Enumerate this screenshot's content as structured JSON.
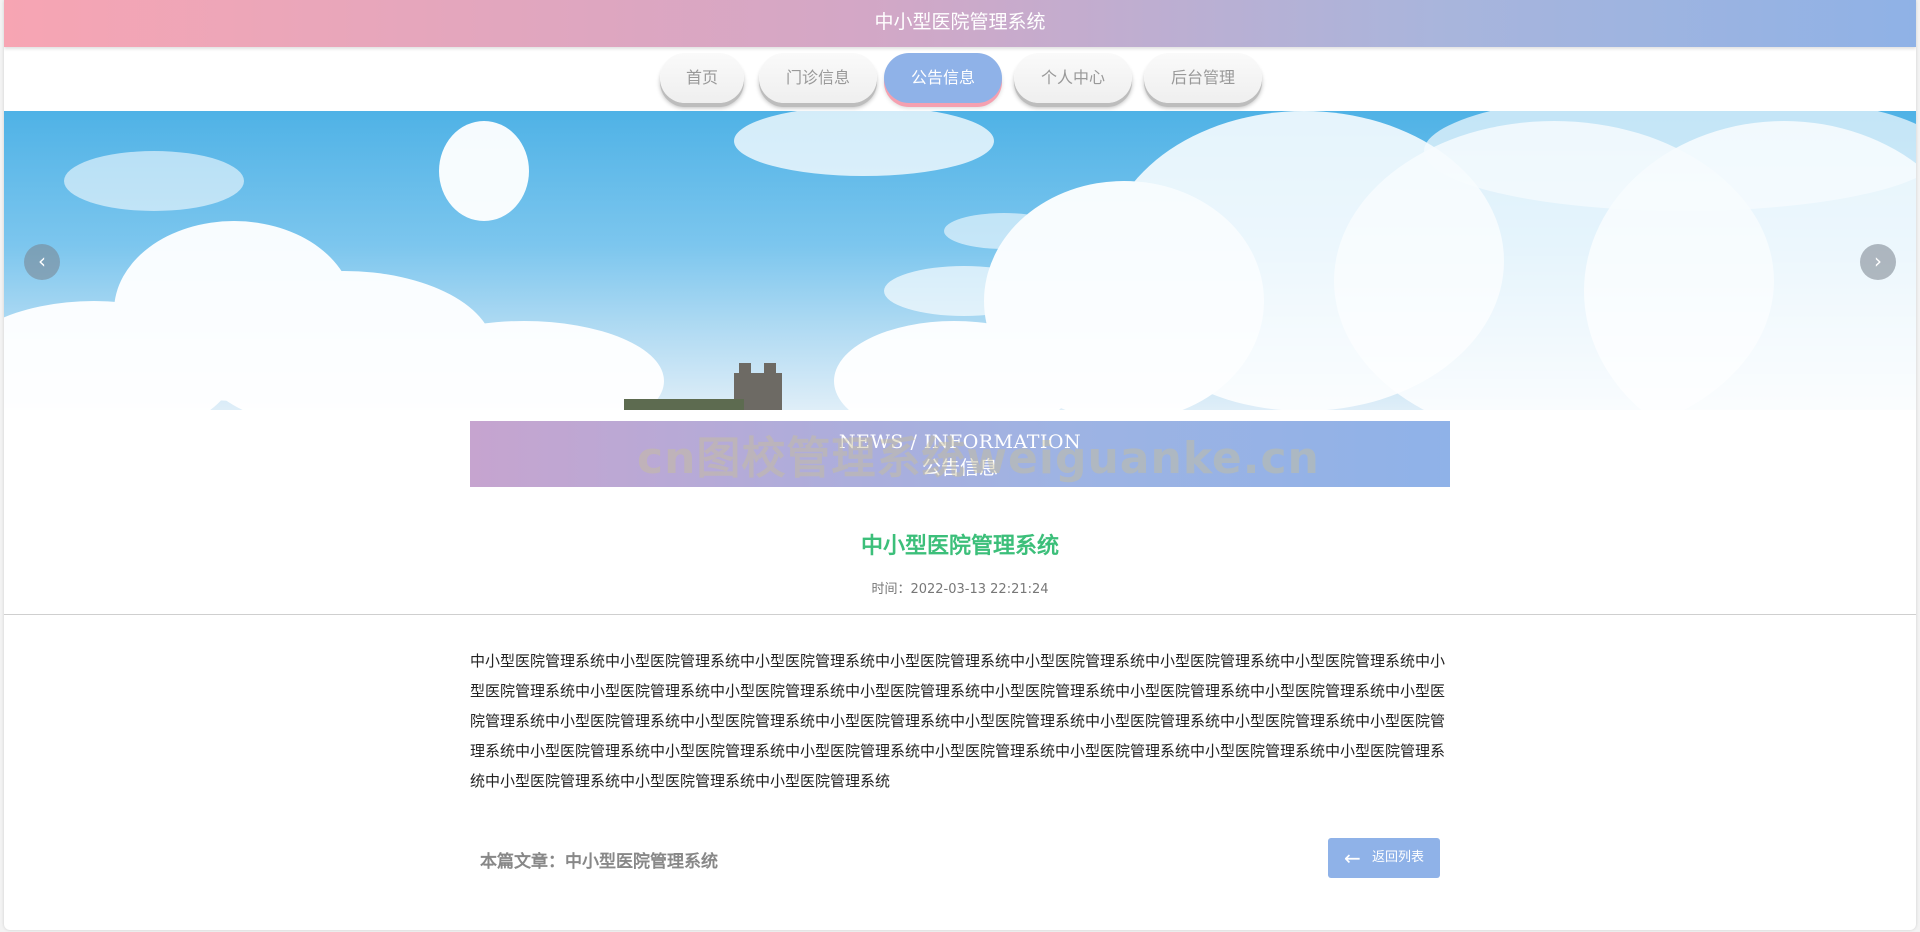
{
  "header": {
    "title": "中小型医院管理系统"
  },
  "nav": {
    "items": [
      {
        "label": "首页"
      },
      {
        "label": "门诊信息"
      },
      {
        "label": "公告信息"
      },
      {
        "label": "个人中心"
      },
      {
        "label": "后台管理"
      }
    ],
    "active": "公告信息"
  },
  "banner": {
    "prev_icon": "chevron-left-icon",
    "next_icon": "chevron-right-icon"
  },
  "section": {
    "title_en": "NEWS / INFORMATION",
    "title_cn": "公告信息"
  },
  "watermark": "cn图校管理系统weiguanke.cn",
  "article": {
    "title": "中小型医院管理系统",
    "time_label": "时间：",
    "time": "2022-03-13 22:21:24",
    "body": "中小型医院管理系统中小型医院管理系统中小型医院管理系统中小型医院管理系统中小型医院管理系统中小型医院管理系统中小型医院管理系统中小型医院管理系统中小型医院管理系统中小型医院管理系统中小型医院管理系统中小型医院管理系统中小型医院管理系统中小型医院管理系统中小型医院管理系统中小型医院管理系统中小型医院管理系统中小型医院管理系统中小型医院管理系统中小型医院管理系统中小型医院管理系统中小型医院管理系统中小型医院管理系统中小型医院管理系统中小型医院管理系统中小型医院管理系统中小型医院管理系统中小型医院管理系统中小型医院管理系统中小型医院管理系统中小型医院管理系统中小型医院管理系统"
  },
  "footer": {
    "current_label": "本篇文章：中小型医院管理系统",
    "back_label": "返回列表",
    "back_icon": "arrow-left-icon"
  },
  "colors": {
    "accent": "#8fb2e8",
    "title_green": "#3cbf7a",
    "pink": "#f7a5b3"
  }
}
